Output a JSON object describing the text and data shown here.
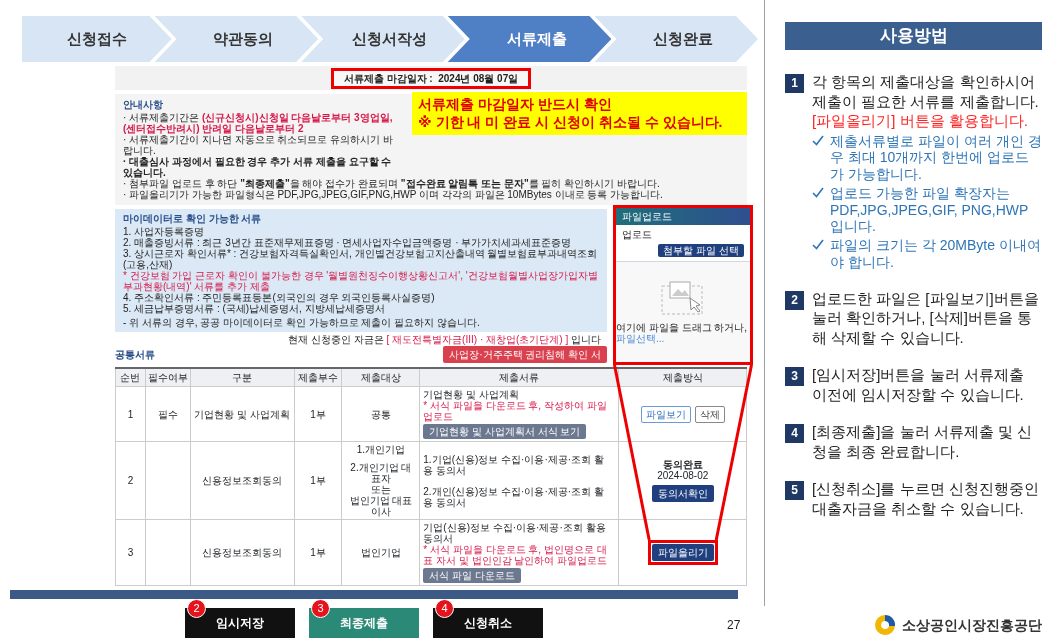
{
  "steps": [
    {
      "label": "신청접수",
      "selected": false
    },
    {
      "label": "약관동의",
      "selected": false
    },
    {
      "label": "신청서작성",
      "selected": false
    },
    {
      "label": "서류제출",
      "selected": true
    },
    {
      "label": "신청완료",
      "selected": false
    }
  ],
  "deadline": {
    "label": "서류제출 마감일자 :",
    "value": "2024년 08월 07일"
  },
  "callout": [
    "서류제출 마감일자 반드시 확인",
    "※ 기한 내 미 완료 시 신청이 취소될 수 있습니다."
  ],
  "notice": {
    "title": "안내사항",
    "items": [
      {
        "kind": "mixed",
        "text": "· 서류제출기간은 ",
        "highlight": "(신규신청시)신청일 다음날로부터 3영업일, (센터접수반려시) 반려일 다음날로부터 2"
      },
      {
        "kind": "normal",
        "text": "· 서류제출기간이 지나면 자동으로 취소되므로 유의하시기 바랍니다."
      },
      {
        "kind": "normal",
        "text": "**· 대출심사 과정에서 필요한 경우 추가 서류 제출을 요구할 수 있습니다.**"
      },
      {
        "kind": "normal",
        "text": "· 첨부파일 업로드 후 하단 **\"최종제출\"**을 해야 접수가 완료되며 **\"접수완료 알림톡 또는 문자\"**를 필히 확인하시기 바랍니다."
      },
      {
        "kind": "normal",
        "text": "· 파일올리기가 가능한 파일형식은 PDF,JPG,JPEG,GIF,PNG,HWP 이며 각각의 파일은 10MBytes 이내로 등록 가능합니다."
      }
    ]
  },
  "mydata": {
    "title": "마이데이터로 확인 가능한 서류",
    "items": [
      {
        "kind": "normal",
        "text": "1. 사업자등록증명"
      },
      {
        "kind": "normal",
        "text": "2. 매출증빙서류 : 최근 3년간 표준재무제표증명 · 면세사업자수입금액증명 · 부가가치세과세표준증명"
      },
      {
        "kind": "normal",
        "text": "3. 상시근로자 확인서류* : 건강보험자격득실확인서, 개인별건강보험고지산출내역 월별보험료부과내역조회(고용,산재)"
      },
      {
        "kind": "warning",
        "text": "* 건강보험 가입 근로자 확인이 불가능한 경우 '월별원천징수이행상황신고서', '건강보험월별사업장가입자별부과현황(내역)' 서류를 추가 제출"
      },
      {
        "kind": "normal",
        "text": "4. 주소확인서류 : 주민등록표등본(외국인의 경우 외국인등록사실증명)"
      },
      {
        "kind": "normal",
        "text": "5. 세금납부증명서류 : (국세)납세증명서, 지방세납세증명서"
      },
      {
        "kind": "note",
        "text": "- 위 서류의 경우, 공공 마이데이터로 확인 가능하므로 제출이 필요하지 않습니다."
      }
    ]
  },
  "current_fund": {
    "prefix": "현재 신청중인 자금은 ",
    "highlight": "[ 재도전특별자금(III) · 재창업(초기단계) ]",
    "suffix": " 입니다"
  },
  "section_title": "공통서류",
  "rights_button": "사업장·거주주택 권리침해 확인 서",
  "popup": {
    "title": "파일업로드",
    "label": "업로드",
    "select_button": "첨부할 파일 선택",
    "drop_text": "여기에 파일을 드래그 하거나, ",
    "drop_link": "파일선택..."
  },
  "table": {
    "columns": [
      "순번",
      "필수여부",
      "구분",
      "제출부수",
      "제출대상",
      "제출서류",
      "제출방식"
    ],
    "rows": [
      {
        "no": "1",
        "required": "필수",
        "category": "기업현황 및 사업계획",
        "copies": "1부",
        "target": [
          "공통"
        ],
        "docs": [
          {
            "kind": "normal",
            "text": "기업현황 및 사업계획"
          },
          {
            "kind": "warning",
            "text": "* 서식 파일을 다운로드 후, 작성하여 파일업로드"
          }
        ],
        "doc_button": "기업현황 및 사업계획서 서식 보기",
        "method": {
          "kind": "view_delete",
          "buttons": [
            "파일보기",
            "삭제"
          ],
          "highlighted": false
        }
      },
      {
        "no": "2",
        "required": "",
        "category": "신용정보조회동의",
        "copies": "1부",
        "target": [
          "1.개인기업",
          "2.개인기업 대표자",
          "또는",
          "법인기업 대표이사"
        ],
        "docs": [
          {
            "kind": "normal",
            "text": "1.기업(신용)정보 수집·이용·제공·조회 활용 동의서"
          },
          {
            "kind": "normal",
            "text": "2.개인(신용)정보 수집·이용·제공·조회 활용 동의서"
          }
        ],
        "method": {
          "kind": "consent",
          "status": "동의완료",
          "date": "2024-08-02",
          "buttons": [
            "동의서확인"
          ],
          "highlighted": false
        }
      },
      {
        "no": "3",
        "required": "",
        "category": "신용정보조회동의",
        "copies": "1부",
        "target": [
          "법인기업"
        ],
        "docs": [
          {
            "kind": "normal",
            "text": "기업(신용)정보 수집·이용·제공·조회 활용 동의서"
          },
          {
            "kind": "warning",
            "text": "* 서식 파일을 다운로드 후, 법인명으로 대표 자서 및 법인인감 날인하여 파일업로드"
          }
        ],
        "doc_button": "서식 파일 다운로드",
        "method": {
          "kind": "upload",
          "buttons": [
            "파일올리기"
          ],
          "highlighted": true
        }
      }
    ]
  },
  "actions": [
    {
      "number": "2",
      "label": "임시저장",
      "kind": "dark"
    },
    {
      "number": "3",
      "label": "최종제출",
      "kind": "primary"
    },
    {
      "number": "4",
      "label": "신청취소",
      "kind": "dark"
    }
  ],
  "guide": {
    "title": "사용방법",
    "items": [
      {
        "number": "1",
        "text": "각 항목의 제출대상을 확인하시어 제출이 필요한 서류를 제출합니다. ",
        "highlight": "[파일올리기] 버튼을 활용합니다.",
        "notes": [
          "제출서류별로 파일이 여러 개인 경우 최대 10개까지 한번에 업로드가 가능합니다.",
          "업로드 가능한 파일 확장자는 PDF,JPG,JPEG,GIF, PNG,HWP 입니다.",
          "파일의 크기는 각 20MByte 이내여야 합니다."
        ]
      },
      {
        "number": "2",
        "text": "업로드한 파일은 [파일보기]버튼을 눌러 확인하거나, [삭제]버튼을 통해 삭제할 수 있습니다."
      },
      {
        "number": "3",
        "text": "[임시저장]버튼을 눌러 서류제출 이전에 임시저장할 수 있습니다."
      },
      {
        "number": "4",
        "text": "[최종제출]을 눌러 서류제출 및 신청을 최종 완료합니다."
      },
      {
        "number": "5",
        "text": "[신청취소]를 누르면 신청진행중인 대출자금을 취소할 수 있습니다."
      }
    ]
  },
  "footer": {
    "page": "27",
    "org": "소상공인시장진흥공단"
  }
}
